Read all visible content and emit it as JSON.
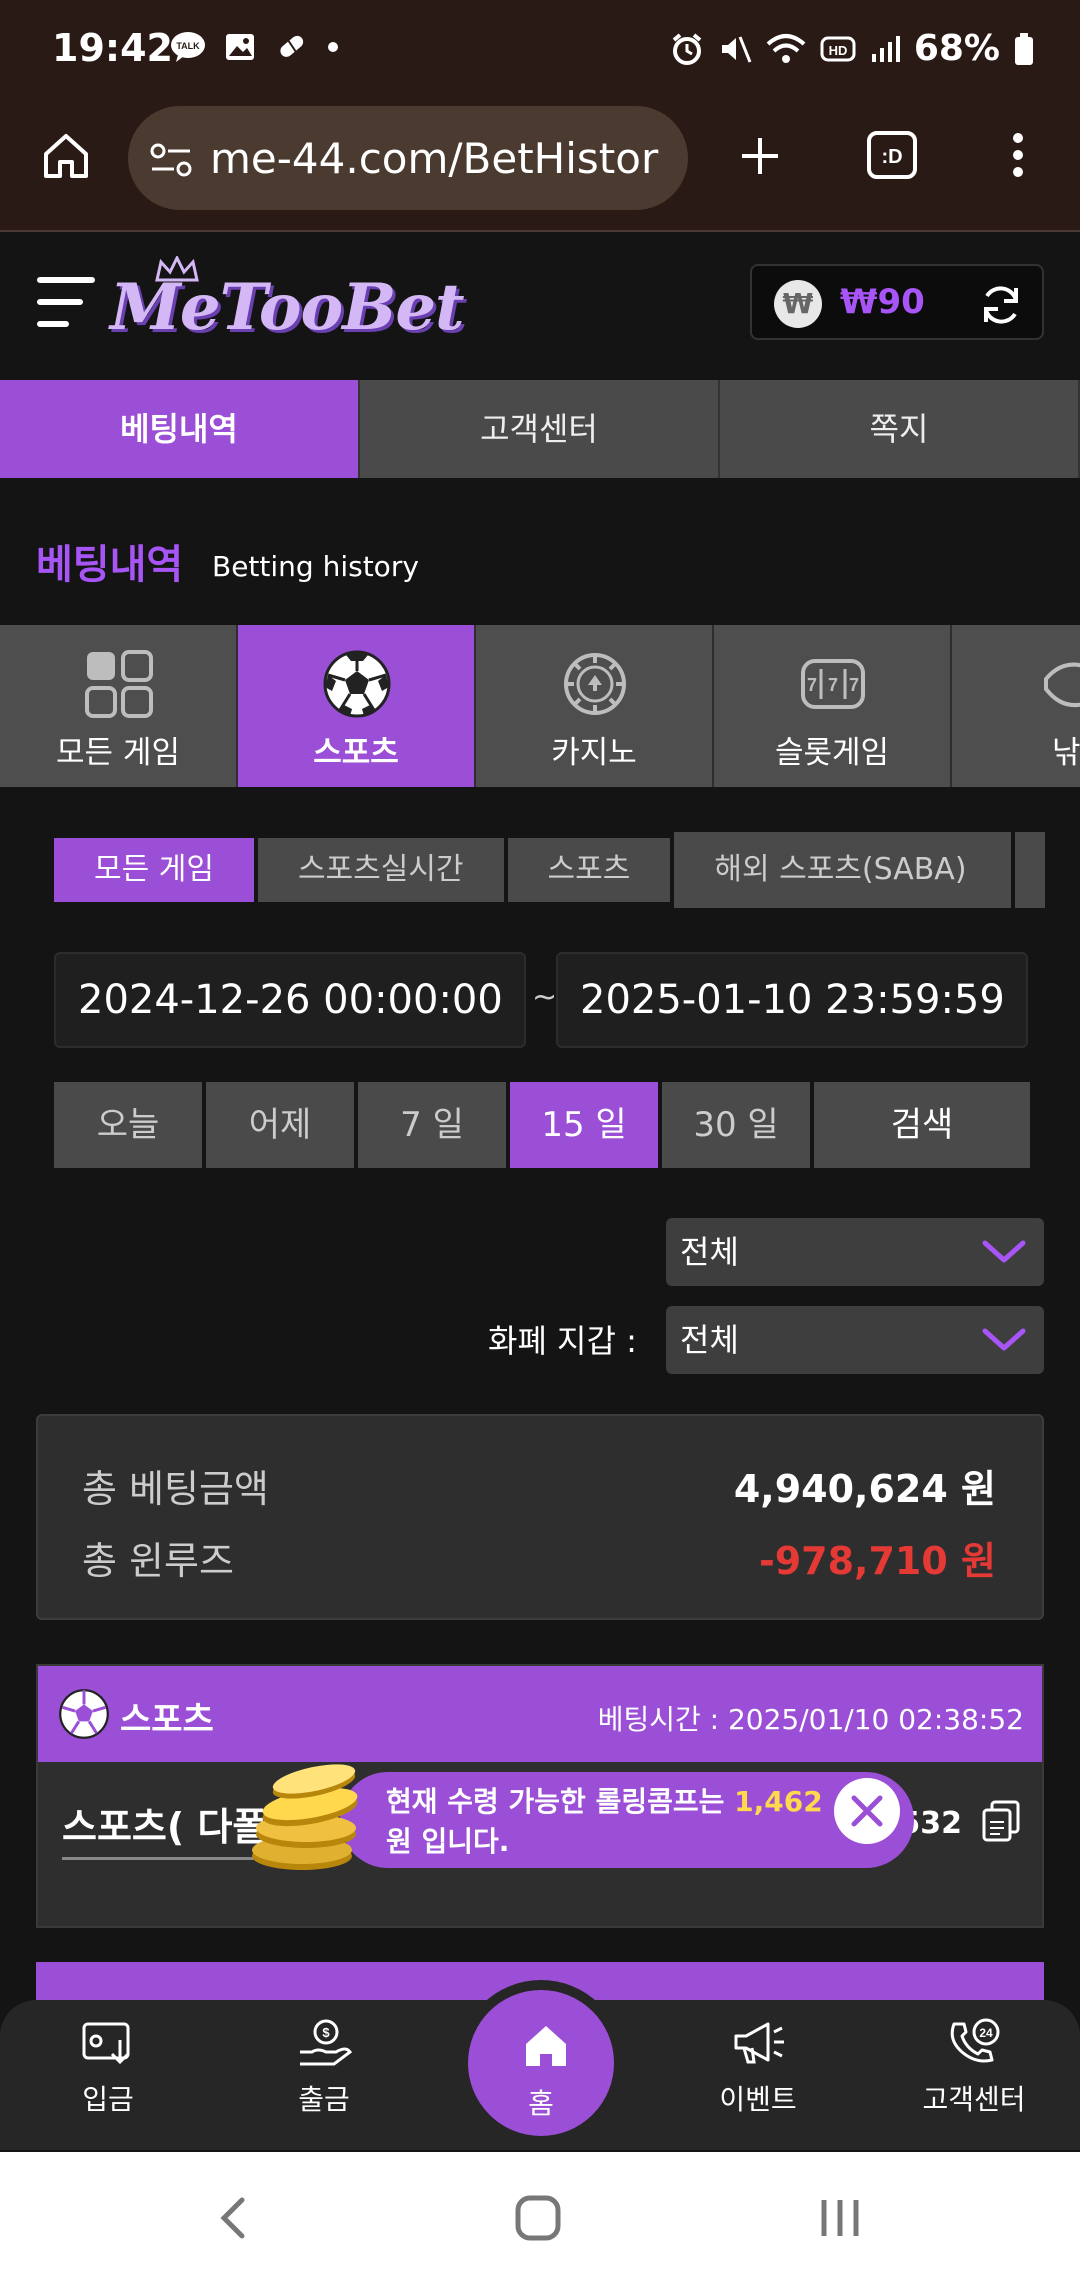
{
  "status_bar": {
    "time": "19:42",
    "battery": "68%"
  },
  "browser": {
    "url": "me-44.com/BetHistor"
  },
  "header": {
    "logo_text": "MeTooBet",
    "balance": "₩90",
    "currency_icon": "₩"
  },
  "top_tabs": [
    {
      "label": "베팅내역",
      "active": true
    },
    {
      "label": "고객센터",
      "active": false
    },
    {
      "label": "쪽지",
      "active": false
    }
  ],
  "section": {
    "title": "베팅내역",
    "subtitle": "Betting history"
  },
  "category_tabs": [
    {
      "label": "모든 게임",
      "icon": "grid-icon",
      "active": false
    },
    {
      "label": "스포츠",
      "icon": "soccer-ball-icon",
      "active": true
    },
    {
      "label": "카지노",
      "icon": "casino-chip-icon",
      "active": false
    },
    {
      "label": "슬롯게임",
      "icon": "slot-machine-icon",
      "active": false
    },
    {
      "label": "낚시",
      "icon": "fish-icon",
      "active": false
    }
  ],
  "filter_tabs": [
    {
      "label": "모든 게임",
      "active": true
    },
    {
      "label": "스포츠실시간",
      "active": false
    },
    {
      "label": "스포츠",
      "active": false
    },
    {
      "label": "해외 스포츠(SABA)",
      "active": false
    }
  ],
  "date_range": {
    "from": "2024-12-26 00:00:00",
    "separator": "~",
    "to": "2025-01-10 23:59:59"
  },
  "quick_range": [
    {
      "label": "오늘",
      "active": false
    },
    {
      "label": "어제",
      "active": false
    },
    {
      "label": "7 일",
      "active": false
    },
    {
      "label": "15 일",
      "active": true
    },
    {
      "label": "30 일",
      "active": false
    }
  ],
  "search_label": "검색",
  "select_all": "전체",
  "currency_wallet_label": "화폐 지갑 :",
  "currency_wallet_value": "전체",
  "summary": {
    "total_bet_label": "총 베팅금액",
    "total_bet_value": "4,940,624 원",
    "total_winloss_label": "총 윈루즈",
    "total_winloss_value": "-978,710 원"
  },
  "bet_card": {
    "category": "스포츠",
    "bet_time_label": "베팅시간 : 2025/01/10 02:38:52",
    "bet_name": "스포츠( 다폴",
    "bet_id": "3532"
  },
  "toast": {
    "line1_prefix": "현재 수령 가능한 롤링콤프는",
    "amount": "1,462",
    "line2": "원 입니다."
  },
  "bottom_nav": [
    {
      "label": "입금",
      "icon": "deposit-icon"
    },
    {
      "label": "출금",
      "icon": "withdraw-icon"
    },
    {
      "label": "홈",
      "icon": "home-icon"
    },
    {
      "label": "이벤트",
      "icon": "megaphone-icon"
    },
    {
      "label": "고객센터",
      "icon": "support-24-icon"
    }
  ],
  "colors": {
    "accent": "#9b4fd6",
    "negative": "#e53935",
    "highlight": "#ffd84d"
  }
}
